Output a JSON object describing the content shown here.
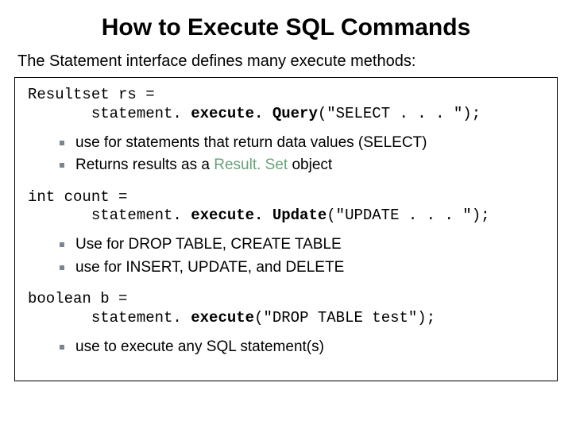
{
  "title": "How to Execute SQL Commands",
  "intro": "The Statement interface defines many execute methods:",
  "block1": {
    "line1": "Resultset rs =",
    "line2_prefix": "       statement. ",
    "line2_method": "execute. Query",
    "line2_suffix": "(\"SELECT . . . \");",
    "bullets": {
      "b1": "use for statements that return data values (SELECT)",
      "b2_prefix": "Returns results as a ",
      "b2_result": "Result. Set",
      "b2_suffix": " object"
    }
  },
  "block2": {
    "line1": "int count =",
    "line2_prefix": "       statement. ",
    "line2_method": "execute. Update",
    "line2_suffix": "(\"UPDATE . . . \");",
    "bullets": {
      "b1": "Use for  DROP TABLE, CREATE TABLE",
      "b2": "use for INSERT, UPDATE, and DELETE"
    }
  },
  "block3": {
    "line1": "boolean b =",
    "line2_prefix": "       statement. ",
    "line2_method": "execute",
    "line2_suffix": "(\"DROP TABLE test\");",
    "bullets": {
      "b1": "use to execute any SQL statement(s)"
    }
  }
}
